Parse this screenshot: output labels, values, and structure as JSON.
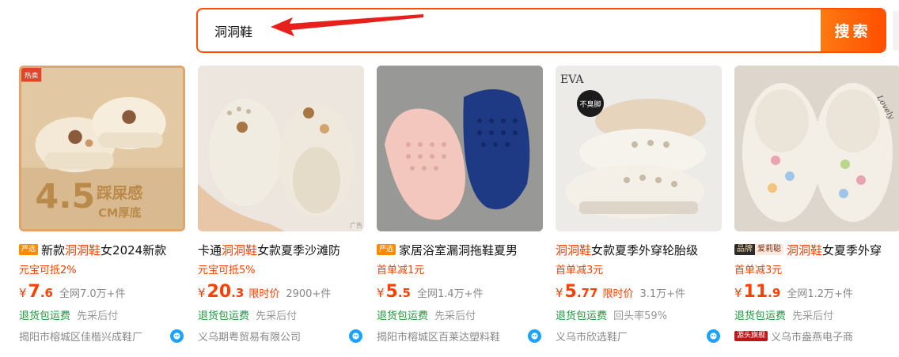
{
  "search": {
    "value": "洞洞鞋",
    "button_label": "搜索"
  },
  "products": [
    {
      "image": {
        "badge": "热卖",
        "overlay_big": "4.5",
        "overlay_text": "踩屎感",
        "overlay_sub": "CM厚底"
      },
      "tag": "严选",
      "title_pre": "新款",
      "title_hl": "洞洞鞋",
      "title_post": "女2024新款",
      "promo": "元宝可抵2%",
      "currency": "¥",
      "price_int": "7",
      "price_dec": ".6",
      "price_tag": "",
      "sales": "全网7.0万+件",
      "service_a": "退货包运费",
      "service_b": "先采后付",
      "shop_badge": "",
      "shop": "揭阳市榕城区佳楷兴成鞋厂"
    },
    {
      "image": {
        "watermark": "广告"
      },
      "tag": "",
      "title_pre": "卡通",
      "title_hl": "洞洞鞋",
      "title_post": "女款夏季沙滩防",
      "promo": "元宝可抵5%",
      "currency": "¥",
      "price_int": "20",
      "price_dec": ".3",
      "price_tag": "限时价",
      "sales": "2900+件",
      "service_a": "退货包运费",
      "service_b": "先采后付",
      "shop_badge": "",
      "shop": "义乌期粤贸易有限公司"
    },
    {
      "image": {},
      "tag": "严选",
      "title_pre": "家居浴室漏洞拖鞋夏男",
      "title_hl": "",
      "title_post": "",
      "promo": "首单减1元",
      "currency": "¥",
      "price_int": "5",
      "price_dec": ".5",
      "price_tag": "",
      "sales": "全网1.4万+件",
      "service_a": "退货包运费",
      "service_b": "先采后付",
      "shop_badge": "",
      "shop": "揭阳市榕城区百莱达塑料鞋"
    },
    {
      "image": {
        "label_eva": "EVA",
        "label_round": "不臭脚"
      },
      "tag": "",
      "title_pre": "",
      "title_hl": "洞洞鞋",
      "title_post": "女款夏季外穿轮胎级",
      "promo": "首单减3元",
      "currency": "¥",
      "price_int": "5",
      "price_dec": ".77",
      "price_tag": "限时价",
      "sales": "3.1万+件",
      "service_a": "退货包运费",
      "service_b": "回头率59%",
      "shop_badge": "",
      "shop": "义乌市欣选鞋厂"
    },
    {
      "image": {
        "script": "Lovely"
      },
      "tag_brand_a": "品牌",
      "tag_brand_b": "爱莉聪",
      "tag": "",
      "title_pre": "",
      "title_hl": "洞洞鞋",
      "title_post": "女夏季外穿",
      "promo": "首单减3元",
      "currency": "¥",
      "price_int": "11",
      "price_dec": ".9",
      "price_tag": "",
      "sales": "全网1.2万+件",
      "service_a": "退货包运费",
      "service_b": "先采后付",
      "shop_badge": "源头旗舰",
      "shop": "义乌市盎燕电子商"
    }
  ],
  "colors": {
    "accent": "#ff5000",
    "price": "#ff4000",
    "service": "#1a9a3a"
  },
  "icons": {
    "chat": "wangwang-chat-icon",
    "annotation": "red-arrow"
  }
}
